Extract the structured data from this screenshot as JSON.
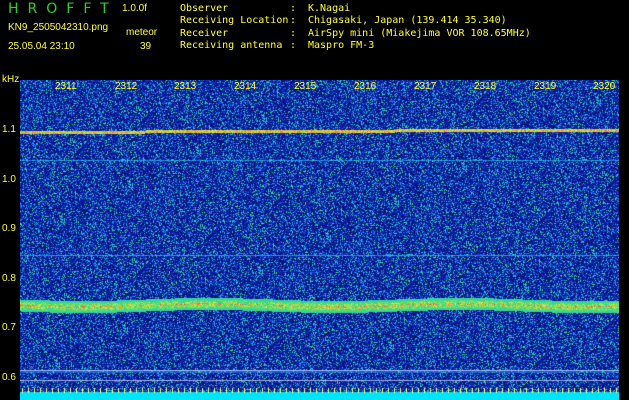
{
  "header": {
    "app_title": "HROFFT",
    "version": "1.0.0f",
    "filename": "KN9_2505042310.png",
    "detector": "meteor",
    "timestamp": "25.05.04 23:10",
    "count": "39"
  },
  "info": [
    {
      "key": "Observer",
      "value": "K.Nagai"
    },
    {
      "key": "Receiving Location",
      "value": "Chigasaki, Japan (139.414 35.340)"
    },
    {
      "key": "Receiver",
      "value": "AirSpy mini (Miakejima VOR 108.65MHz)"
    },
    {
      "key": "Receiving antenna",
      "value": "Maspro FM-3"
    }
  ],
  "axis": {
    "y_unit": "kHz",
    "y_ticks": [
      "1.1",
      "1.0",
      "0.9",
      "0.8",
      "0.7",
      "0.6"
    ],
    "x_ticks": [
      "2311",
      "2312",
      "2313",
      "2314",
      "2315",
      "2316",
      "2317",
      "2318",
      "2319",
      "2320"
    ]
  },
  "colors": {
    "background": "#000000",
    "label": "#ffff33",
    "title": "#2ecc2e",
    "noise_floor": "#0a1a8c",
    "baseline_strip": "#00e5ff"
  }
}
